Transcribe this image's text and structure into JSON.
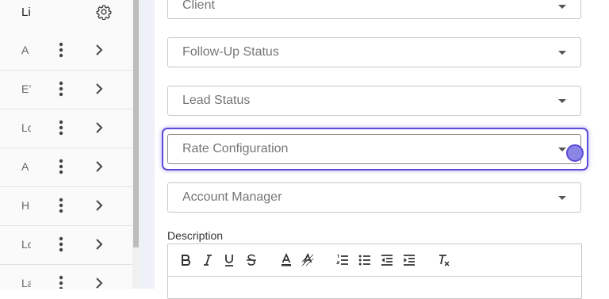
{
  "list": {
    "header_label": "Li",
    "header_icon": "gear-icon",
    "rows": [
      {
        "label": "A"
      },
      {
        "label": "E’"
      },
      {
        "label": "Lo"
      },
      {
        "label": "A"
      },
      {
        "label": "H"
      },
      {
        "label": "Lo"
      },
      {
        "label": "La"
      }
    ]
  },
  "form": {
    "client_value": "Client",
    "follow_up_status_placeholder": "Follow-Up Status",
    "lead_status_placeholder": "Lead Status",
    "rate_configuration_placeholder": "Rate Configuration",
    "account_manager_placeholder": "Account Manager",
    "description_label": "Description"
  },
  "editor_toolbar": {
    "buttons": [
      "bold-icon",
      "italic-icon",
      "underline-icon",
      "strikethrough-icon",
      "text-color-icon",
      "highlight-icon",
      "ordered-list-icon",
      "bullet-list-icon",
      "outdent-icon",
      "indent-icon",
      "clear-format-icon"
    ]
  },
  "colors": {
    "focus_accent": "#5b4bdb",
    "border": "#c7c7c7"
  }
}
